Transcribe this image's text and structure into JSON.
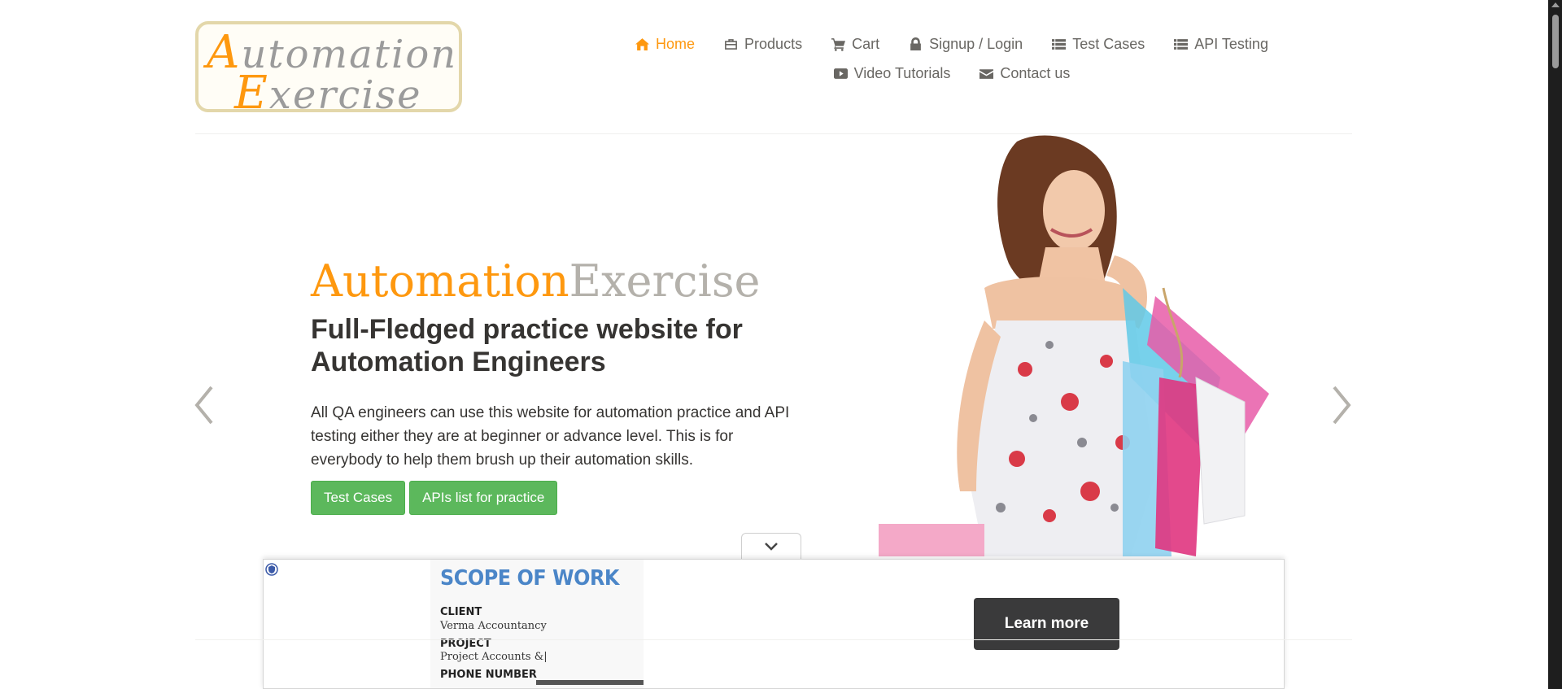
{
  "logo": {
    "line1_cap": "A",
    "line1_rest": "utomation",
    "line2_cap": "E",
    "line2_rest": "xercise"
  },
  "nav": {
    "row1": [
      {
        "label": "Home",
        "icon": "home-icon",
        "active": true
      },
      {
        "label": "Products",
        "icon": "briefcase-icon"
      },
      {
        "label": "Cart",
        "icon": "cart-icon"
      },
      {
        "label": "Signup / Login",
        "icon": "lock-icon"
      },
      {
        "label": "Test Cases",
        "icon": "list-icon"
      },
      {
        "label": "API Testing",
        "icon": "list-icon"
      }
    ],
    "row2": [
      {
        "label": "Video Tutorials",
        "icon": "youtube-play-icon"
      },
      {
        "label": "Contact us",
        "icon": "envelope-icon"
      }
    ]
  },
  "slide": {
    "brand_part1": "Automation",
    "brand_part2": "Exercise",
    "headline": "Full-Fledged practice website for Automation Engineers",
    "description": "All QA engineers can use this website for automation practice and API testing either they are at beginner or advance level. This is for everybody to help them brush up their automation skills.",
    "buttons": {
      "test_cases": "Test Cases",
      "apis_list": "APIs list for practice"
    }
  },
  "ad": {
    "title": "SCOPE OF WORK",
    "client_label": "CLIENT",
    "client_value": "Verma Accountancy",
    "project_label": "PROJECT",
    "project_value": "Project Accounts &|",
    "phone_label": "PHONE NUMBER",
    "cta": "Learn more"
  },
  "colors": {
    "accent": "#fe980f",
    "button_green": "#5cb85c",
    "text_dark": "#363432",
    "nav_text": "#696763",
    "brand_gray": "#b4b1ab",
    "ad_title_blue": "#4b86c8",
    "ad_cta_bg": "#3a3a3b"
  }
}
